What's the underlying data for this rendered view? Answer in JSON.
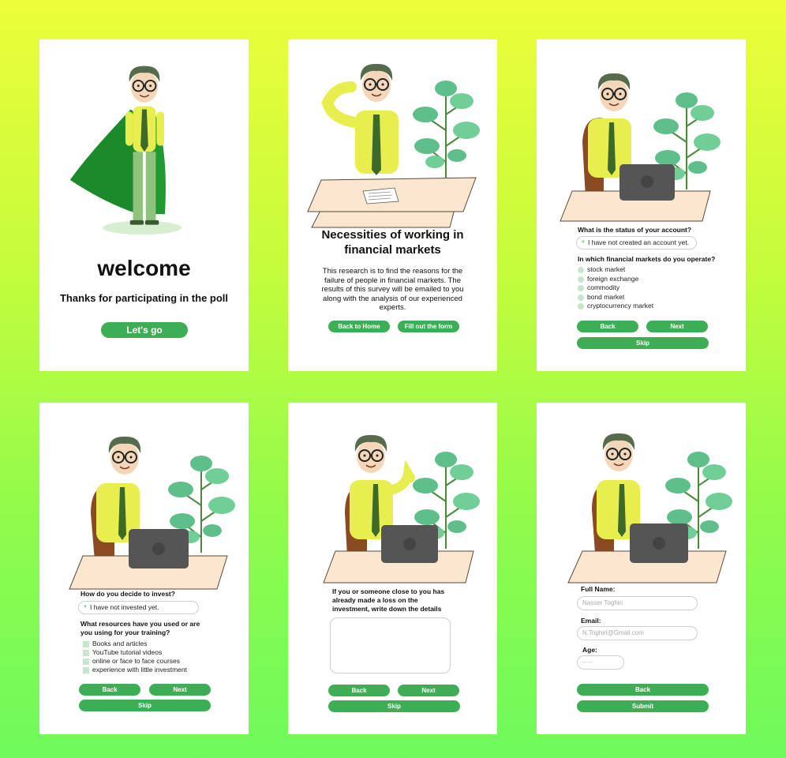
{
  "screens": {
    "welcome": {
      "title": "welcome",
      "subtitle": "Thanks for participating in the poll",
      "cta": "Let's go"
    },
    "intro": {
      "title": "Necessities of working in financial markets",
      "body": "This research is to find the reasons for the failure of people in financial markets. The results of this survey will be emailed to you along with the analysis of our experienced experts.",
      "back_button": "Back to Home",
      "form_button": "Fill out the form"
    },
    "account": {
      "question1": "What is the status of your account?",
      "answer1": "I have not created an account yet.",
      "question2": "In which financial markets do you operate?",
      "options": [
        "stock market",
        "foreign exchange",
        "commodity",
        "bond market",
        "cryptocurrency market"
      ],
      "back": "Back",
      "next": "Next",
      "skip": "Skip"
    },
    "invest": {
      "question1": "How do you decide to invest?",
      "answer1": "I have not invested yet.",
      "question2": "What resources have you used or are you using for your training?",
      "options": [
        "Books and articles",
        "YouTube tutorial videos",
        "online or face to face courses",
        "experience with little investment"
      ],
      "back": "Back",
      "next": "Next",
      "skip": "Skip"
    },
    "loss": {
      "question": "If you or someone close to you has already made a loss on the investment, write down the details",
      "textarea_value": "",
      "back": "Back",
      "next": "Next",
      "skip": "Skip"
    },
    "details": {
      "name_label": "Full Name:",
      "name_placeholder": "Nasser Toghiri",
      "email_label": "Email:",
      "email_placeholder": "N.Toghiri@Gmail.com",
      "age_label": "Age:",
      "age_placeholder": "-- --",
      "back": "Back",
      "submit": "Submit"
    }
  },
  "colors": {
    "accent": "#3eae56",
    "option_fill": "#c8e6cc",
    "background_top": "#edfd39",
    "background_bottom": "#6ffa5c"
  },
  "icons": [
    "hero-character-illustration",
    "thinking-character-illustration",
    "laptop-character-illustration",
    "plant-icon",
    "document-icon",
    "dropdown-arrow-icon"
  ]
}
